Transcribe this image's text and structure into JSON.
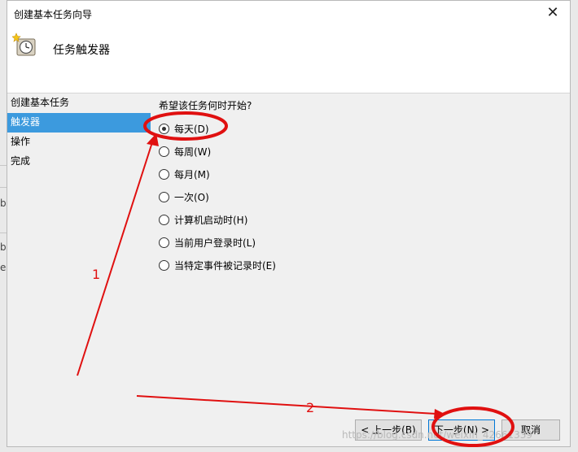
{
  "window": {
    "title": "创建基本任务向导",
    "header_title": "任务触发器"
  },
  "nav": {
    "items": [
      "创建基本任务",
      "触发器",
      "操作",
      "完成"
    ],
    "active_index": 1
  },
  "content": {
    "question": "希望该任务何时开始?",
    "options": [
      "每天(D)",
      "每周(W)",
      "每月(M)",
      "一次(O)",
      "计算机启动时(H)",
      "当前用户登录时(L)",
      "当特定事件被记录时(E)"
    ],
    "selected_index": 0
  },
  "buttons": {
    "prev": "< 上一步(B)",
    "next": "下一步(N) >",
    "cancel": "取消"
  },
  "annotations": {
    "label_1": "1",
    "label_2": "2",
    "color": "#e01010"
  },
  "background_fragments": {
    "b1": "b",
    "b2": "b",
    "c": "e"
  },
  "watermark": "https://blog.csdn.net/weixin_42661339"
}
